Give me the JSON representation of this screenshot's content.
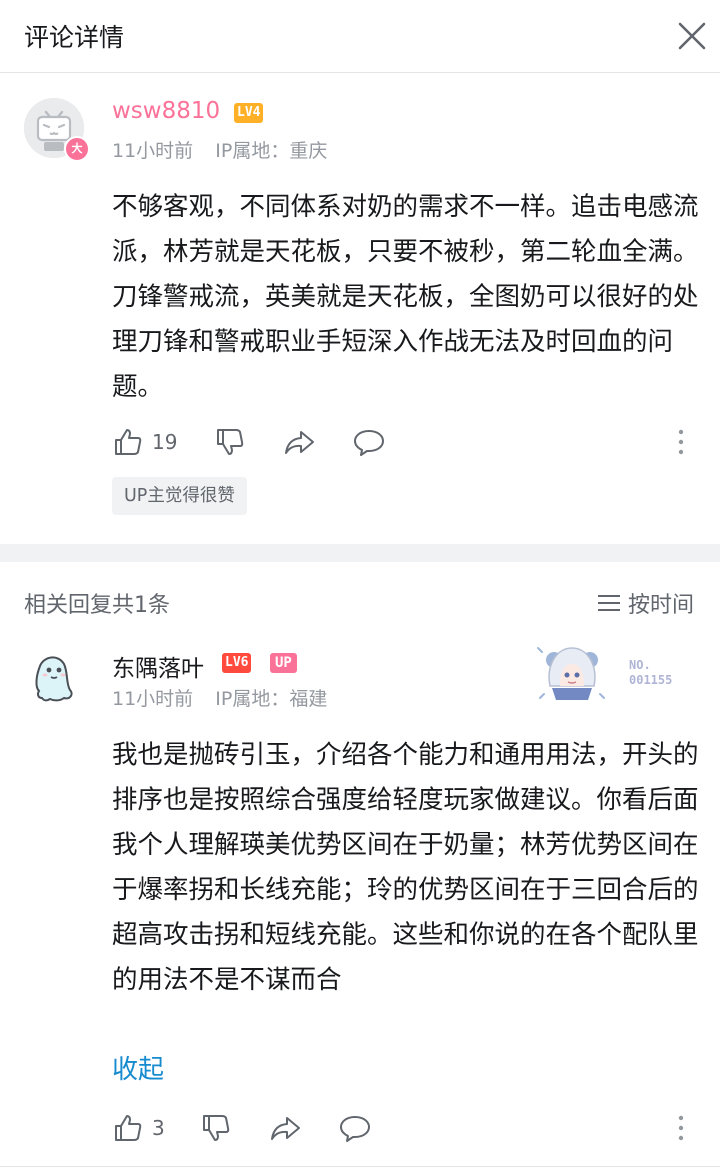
{
  "header": {
    "title": "评论详情",
    "close_icon": "close-icon"
  },
  "main_comment": {
    "username": "wsw8810",
    "username_color": "#fb7299",
    "level": "LV4",
    "level_color": "#ffb027",
    "time": "11小时前",
    "ip_label": "IP属地：重庆",
    "text": "不够客观，不同体系对奶的需求不一样。追击电感流派，林芳就是天花板，只要不被秒，第二轮血全满。刀锋警戒流，英美就是天花板，全图奶可以很好的处理刀锋和警戒职业手短深入作战无法及时回血的问题。",
    "likes": "19",
    "tag": "UP主觉得很赞",
    "avatar_badge": "大"
  },
  "replies_section": {
    "title": "相关回复共1条",
    "sort_label": "按时间"
  },
  "reply": {
    "username": "东隅落叶",
    "level": "LV6",
    "level_color": "#ff4a3d",
    "up_badge": "UP",
    "up_color": "#fb7299",
    "fan_number_label": "NO.",
    "fan_number": "001155",
    "time": "11小时前",
    "ip_label": "IP属地：福建",
    "text": "我也是抛砖引玉，介绍各个能力和通用用法，开头的排序也是按照综合强度给轻度玩家做建议。你看后面我个人理解瑛美优势区间在于奶量；林芳优势区间在于爆率拐和长线充能；玲的优势区间在于三回合后的超高攻击拐和短线充能。这些和你说的在各个配队里的用法不是不谋而合",
    "collapse_label": "收起",
    "likes": "3"
  }
}
